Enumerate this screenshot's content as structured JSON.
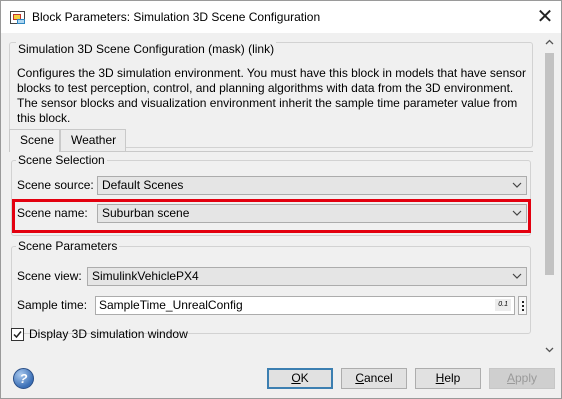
{
  "window": {
    "title": "Block Parameters: Simulation 3D Scene Configuration",
    "close_symbol": "✕"
  },
  "mask": {
    "title": "Simulation 3D Scene Configuration (mask) (link)",
    "description": "Configures the 3D simulation environment. You must have this block in models that have sensor blocks to test perception, control, and planning algorithms with data from the 3D environment. The sensor blocks and visualization environment inherit the sample time parameter value from this block."
  },
  "tabs": [
    {
      "label": "Scene",
      "active": true
    },
    {
      "label": "Weather",
      "active": false
    }
  ],
  "scene_selection": {
    "title": "Scene Selection",
    "source_label": "Scene source:",
    "source_value": "Default Scenes",
    "name_label": "Scene name:",
    "name_value": "Suburban scene"
  },
  "scene_parameters": {
    "title": "Scene Parameters",
    "view_label": "Scene view:",
    "view_value": "SimulinkVehiclePX4",
    "sample_label": "Sample time:",
    "sample_value": "SampleTime_UnrealConfig",
    "sample_badge": "0.1"
  },
  "display_window": {
    "label": "Display 3D simulation window",
    "checked": true
  },
  "buttons": {
    "ok_u": "O",
    "ok_rest": "K",
    "cancel_u": "C",
    "cancel_rest": "ancel",
    "help_u": "H",
    "help_rest": "elp",
    "apply_u": "A",
    "apply_rest": "pply"
  },
  "help_icon_glyph": "?",
  "colors": {
    "highlight": "#e3000f",
    "default_button_border": "#3c7fb1"
  },
  "icons": [
    "app-icon",
    "close-icon",
    "chevron-down-icon",
    "check-icon",
    "help-icon",
    "scroll-up-icon",
    "scroll-down-icon",
    "kebab-icon"
  ]
}
